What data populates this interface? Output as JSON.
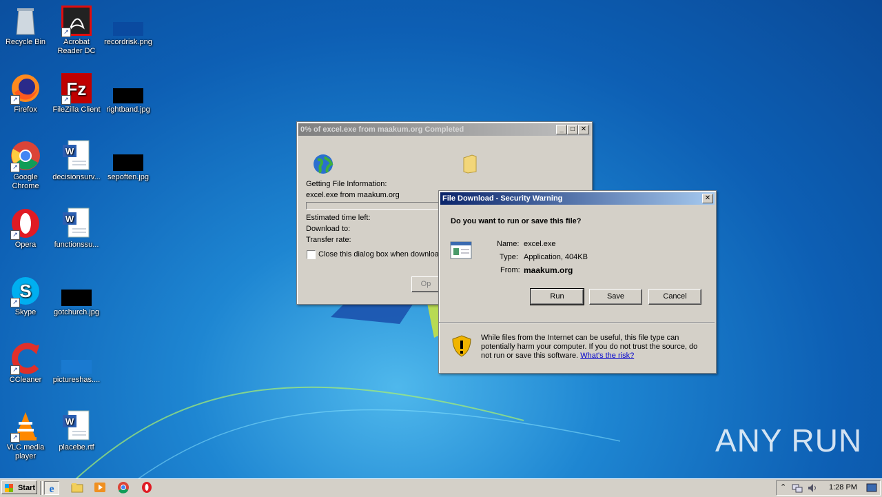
{
  "desktop": {
    "icons": [
      {
        "label": "Recycle Bin",
        "icon": "recycle-bin-icon"
      },
      {
        "label": "Acrobat Reader DC",
        "icon": "acrobat-icon"
      },
      {
        "label": "recordrisk.png",
        "icon": "image-file-icon"
      },
      {
        "label": "Firefox",
        "icon": "firefox-icon"
      },
      {
        "label": "FileZilla Client",
        "icon": "filezilla-icon"
      },
      {
        "label": "rightband.jpg",
        "icon": "image-file-icon"
      },
      {
        "label": "Google Chrome",
        "icon": "chrome-icon"
      },
      {
        "label": "decisionsurv...",
        "icon": "word-doc-icon"
      },
      {
        "label": "sepoften.jpg",
        "icon": "image-file-icon"
      },
      {
        "label": "Opera",
        "icon": "opera-icon"
      },
      {
        "label": "functionssu...",
        "icon": "word-doc-icon"
      },
      {
        "label": "Skype",
        "icon": "skype-icon"
      },
      {
        "label": "gotchurch.jpg",
        "icon": "image-file-icon"
      },
      {
        "label": "CCleaner",
        "icon": "ccleaner-icon"
      },
      {
        "label": "pictureshas....",
        "icon": "image-file-icon"
      },
      {
        "label": "VLC media player",
        "icon": "vlc-icon"
      },
      {
        "label": "placebe.rtf",
        "icon": "word-doc-icon"
      }
    ],
    "watermark": "ANY RUN"
  },
  "download_window": {
    "title": "0% of excel.exe from maakum.org Completed",
    "status": "Getting File Information:",
    "file_line": "excel.exe from maakum.org",
    "est_time_label": "Estimated time left:",
    "download_to_label": "Download to:",
    "transfer_rate_label": "Transfer rate:",
    "close_checkbox_label": "Close this dialog box when download",
    "open_button": "Op"
  },
  "security_dialog": {
    "title": "File Download - Security Warning",
    "question": "Do you want to run or save this file?",
    "name_label": "Name:",
    "name_value": "excel.exe",
    "type_label": "Type:",
    "type_value": "Application, 404KB",
    "from_label": "From:",
    "from_value": "maakum.org",
    "run_button": "Run",
    "save_button": "Save",
    "cancel_button": "Cancel",
    "warning_text": "While files from the Internet can be useful, this file type can potentially harm your computer. If you do not trust the source, do not run or save this software.",
    "risk_link": "What's the risk?"
  },
  "taskbar": {
    "start_label": "Start",
    "clock": "1:28 PM"
  }
}
